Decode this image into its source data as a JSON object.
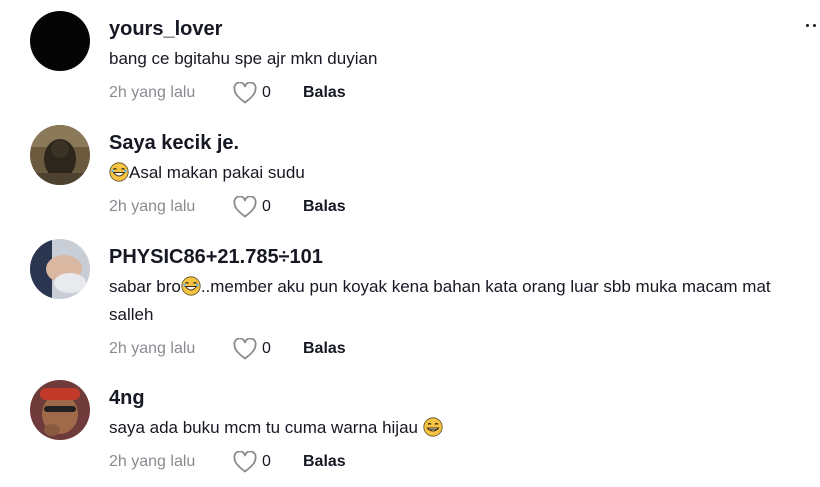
{
  "menu": {
    "more_icon": "more-dots-icon"
  },
  "comments": [
    {
      "username": "yours_lover",
      "text_parts": [
        "bang ce bgitahu spe ajr mkn duyian"
      ],
      "time": "2h yang lalu",
      "likes": "0",
      "reply_label": "Balas"
    },
    {
      "username": "Saya kecik je.",
      "text_parts": [
        "Asal makan pakai sudu"
      ],
      "time": "2h yang lalu",
      "likes": "0",
      "reply_label": "Balas"
    },
    {
      "username": "PHYSIC86+21.785÷101",
      "text_parts": [
        "sabar bro",
        "..member aku pun koyak kena bahan kata orang luar sbb muka macam mat salleh"
      ],
      "time": "2h yang lalu",
      "likes": "0",
      "reply_label": "Balas"
    },
    {
      "username": "4ng",
      "text_parts": [
        "saya ada buku mcm tu cuma warna hijau"
      ],
      "time": "2h yang lalu",
      "likes": "0",
      "reply_label": "Balas"
    }
  ],
  "colors": {
    "text": "#161823",
    "muted": "#8a8b91",
    "emoji": "#f6c343"
  }
}
